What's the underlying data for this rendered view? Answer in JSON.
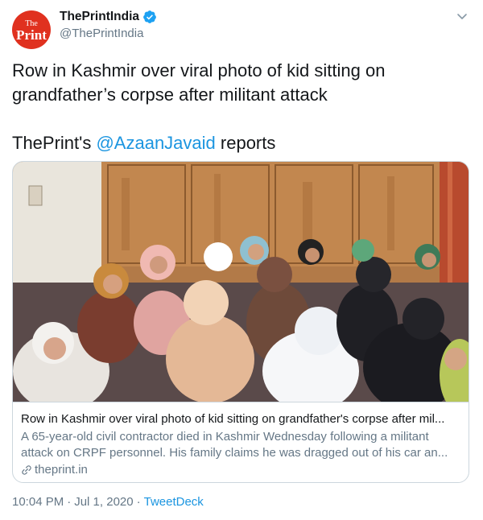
{
  "account": {
    "display_name": "ThePrintIndia",
    "handle": "@ThePrintIndia",
    "avatar_text_top": "The",
    "avatar_text_main": "Print",
    "avatar_color": "#e0311f",
    "verified_icon": "verified-badge-icon"
  },
  "tweet": {
    "text_line1": "Row in Kashmir over viral photo of kid sitting on grandfather’s corpse after militant attack",
    "text_prefix": "ThePrint's ",
    "mention": "@AzaanJavaid",
    "text_suffix": " reports",
    "link_color": "#1b95e0"
  },
  "card": {
    "image_icon": "photo-women-gathered-icon",
    "title": "Row in Kashmir over viral photo of kid sitting on grandfather's corpse after mil...",
    "description": "A 65-year-old civil contractor died in Kashmir Wednesday following a militant attack on CRPF personnel. His family claims he was dragged out of his car an...",
    "domain": "theprint.in"
  },
  "meta": {
    "time": "10:04 PM",
    "separator1": "·",
    "date": "Jul 1, 2020",
    "separator2": "·",
    "source": "TweetDeck"
  }
}
